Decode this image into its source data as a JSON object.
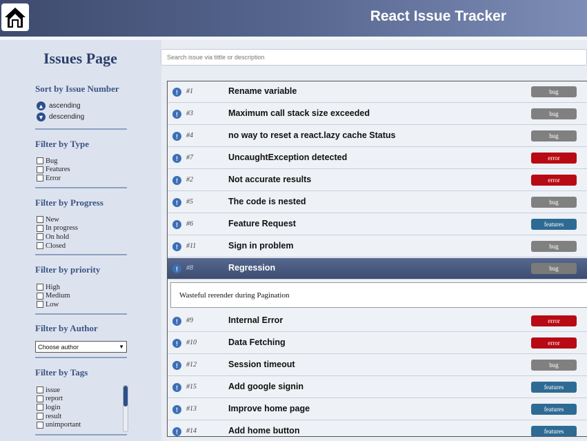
{
  "header": {
    "title": "React Issue Tracker",
    "home_icon": "home-icon"
  },
  "sidebar": {
    "page_title": "Issues Page",
    "sort": {
      "title": "Sort by Issue Number",
      "options": [
        "ascending",
        "descending"
      ]
    },
    "type": {
      "title": "Filter by Type",
      "options": [
        "Bug",
        "Features",
        "Error"
      ]
    },
    "progress": {
      "title": "Filter by Progress",
      "options": [
        "New",
        "In progress",
        "On hold",
        "Closed"
      ]
    },
    "priority": {
      "title": "Filter by priority",
      "options": [
        "High",
        "Medium",
        "Low"
      ]
    },
    "author": {
      "title": "Filter by Author",
      "selected": "Choose author"
    },
    "tags": {
      "title": "Filter by Tags",
      "options": [
        "issue",
        "report",
        "login",
        "result",
        "unimportant"
      ]
    }
  },
  "search": {
    "placeholder": "Search issue via tittle or description"
  },
  "issues": [
    {
      "num": "#1",
      "title": "Rename variable",
      "tag": "bug"
    },
    {
      "num": "#3",
      "title": "Maximum call stack size exceeded",
      "tag": "bug"
    },
    {
      "num": "#4",
      "title": "no way to reset a react.lazy cache Status",
      "tag": "bug"
    },
    {
      "num": "#7",
      "title": "UncaughtException detected",
      "tag": "error"
    },
    {
      "num": "#2",
      "title": "Not accurate results",
      "tag": "error"
    },
    {
      "num": "#5",
      "title": "The code is nested",
      "tag": "bug"
    },
    {
      "num": "#6",
      "title": "Feature Request",
      "tag": "features"
    },
    {
      "num": "#11",
      "title": "Sign in problem",
      "tag": "bug"
    },
    {
      "num": "#8",
      "title": "Regression",
      "tag": "bug",
      "selected": true,
      "description": "Wasteful rerender during Pagination"
    },
    {
      "num": "#9",
      "title": "Internal Error",
      "tag": "error"
    },
    {
      "num": "#10",
      "title": "Data Fetching",
      "tag": "error"
    },
    {
      "num": "#12",
      "title": "Session timeout",
      "tag": "bug"
    },
    {
      "num": "#15",
      "title": "Add google signin",
      "tag": "features"
    },
    {
      "num": "#13",
      "title": "Improve home page",
      "tag": "features"
    },
    {
      "num": "#14",
      "title": "Add home button",
      "tag": "features"
    }
  ],
  "colors": {
    "bug": "#808080",
    "error": "#b80a14",
    "features": "#2e6b94",
    "header": "#4a5a80"
  }
}
